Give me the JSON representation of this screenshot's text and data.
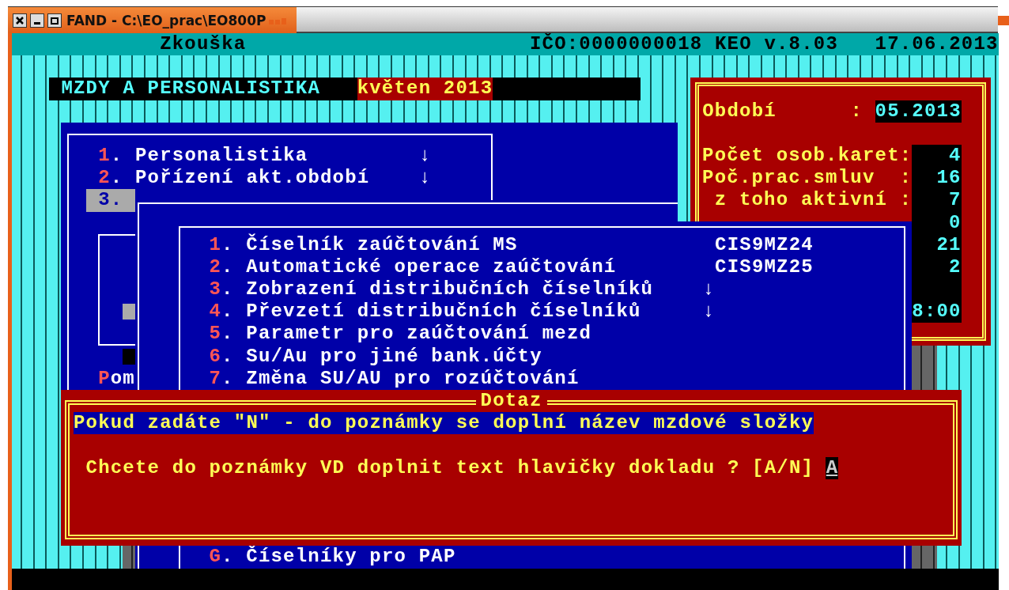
{
  "window": {
    "title": "FAND - C:\\EO_prac\\EO800P"
  },
  "header": {
    "title": "Zkouška",
    "info": "IČO:0000000018 KEO v.8.03",
    "date": "17.06.2013"
  },
  "module_bar": {
    "title": "MZDY A PERSONALISTIKA",
    "period": "květen 2013"
  },
  "main_menu": {
    "items": [
      {
        "hotkey": "1",
        "label": ". Personalistika",
        "arrow": "↓",
        "selected": false
      },
      {
        "hotkey": "2",
        "label": ". Pořízení akt.období",
        "arrow": "↓",
        "selected": false
      },
      {
        "hotkey": "3",
        "label": ".",
        "selected": true
      },
      {
        "hotkey": "P",
        "label": "om",
        "selected": false
      }
    ]
  },
  "info_panel": {
    "period": {
      "label": "Období",
      "separator": ":",
      "value": "05.2013"
    },
    "rows": [
      {
        "label": "Počet osob.karet:",
        "value": "4"
      },
      {
        "label": "Poč.prac.smluv  :",
        "value": "16"
      },
      {
        "label": "z toho aktivní :",
        "value": "7"
      },
      {
        "value": "0"
      },
      {
        "value": "21"
      },
      {
        "value": "2"
      },
      {
        "value": "8:00"
      }
    ]
  },
  "submenu": {
    "items": [
      {
        "hotkey": "1",
        "label": ". Číselník zaúčtování MS",
        "code": "CIS9MZ24",
        "selected": false
      },
      {
        "hotkey": "2",
        "label": ". Automatické operace zaúčtování",
        "code": "CIS9MZ25",
        "selected": false
      },
      {
        "hotkey": "3",
        "label": ". Zobrazení distribučních číselníků",
        "arrow": "↓",
        "selected": false
      },
      {
        "hotkey": "4",
        "label": ". Převzetí distribučních číselníků",
        "arrow": "↓",
        "selected": false
      },
      {
        "hotkey": "5",
        "label": ". Parametr pro zaúčtování mezd",
        "selected": false
      },
      {
        "hotkey": "6",
        "label": ". Su/Au pro jiné bank.účty",
        "selected": false
      },
      {
        "hotkey": "7",
        "label": ". Změna SU/AU pro rozúčtování",
        "selected": false
      },
      {
        "hotkey": "G",
        "label": ". Číselníky pro PAP",
        "selected": false
      }
    ]
  },
  "dialog": {
    "title": "Dotaz",
    "hint": "Pokud zadáte \"N\" - do poznámky se doplní název mzdové složky",
    "question": "Chcete do poznámky VD doplnit text hlavičky dokladu ? [A/N]",
    "answer": "A"
  }
}
